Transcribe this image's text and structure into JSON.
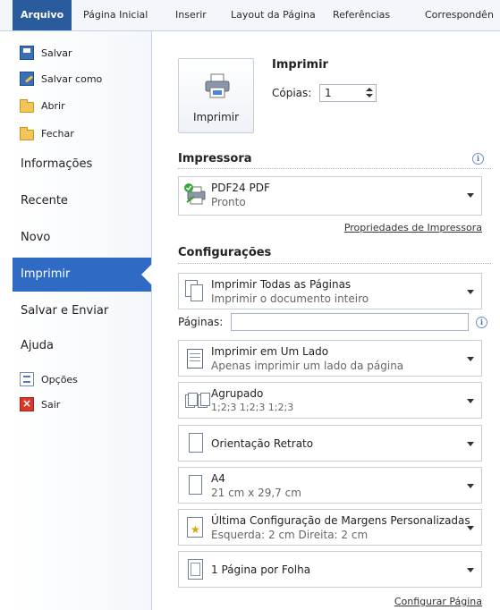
{
  "ribbon": {
    "tabs": [
      "Arquivo",
      "Página Inicial",
      "Inserir",
      "Layout da Página",
      "Referências",
      "Correspondên"
    ]
  },
  "nav": {
    "save": "Salvar",
    "save_as": "Salvar como",
    "open": "Abrir",
    "close": "Fechar",
    "info": "Informações",
    "recent": "Recente",
    "new": "Novo",
    "print": "Imprimir",
    "save_send": "Salvar e Enviar",
    "help": "Ajuda",
    "options": "Opções",
    "exit": "Sair"
  },
  "print": {
    "heading": "Imprimir",
    "button_label": "Imprimir",
    "copies_label": "Cópias:",
    "copies_value": "1"
  },
  "printer": {
    "section": "Impressora",
    "name": "PDF24 PDF",
    "status": "Pronto",
    "properties_link": "Propriedades de Impressora"
  },
  "settings": {
    "section": "Configurações",
    "pages_label": "Páginas:",
    "pages_value": "",
    "page_setup_link": "Configurar Página",
    "items": [
      {
        "title": "Imprimir Todas as Páginas",
        "subtitle": "Imprimir o documento inteiro",
        "icon": "pages-icon"
      },
      {
        "title": "Imprimir em Um Lado",
        "subtitle": "Apenas imprimir um lado da página",
        "icon": "one-side-icon"
      },
      {
        "title": "Agrupado",
        "subtitle": "1;2;3   1;2;3   1;2;3",
        "icon": "collate-icon"
      },
      {
        "title": "Orientação Retrato",
        "subtitle": "",
        "icon": "portrait-icon"
      },
      {
        "title": "A4",
        "subtitle": "21 cm x 29,7 cm",
        "icon": "paper-size-icon"
      },
      {
        "title": "Última Configuração de Margens Personalizadas",
        "subtitle": "Esquerda:  2 cm    Direita:  2 cm",
        "icon": "margins-icon"
      },
      {
        "title": "1 Página por Folha",
        "subtitle": "",
        "icon": "pages-per-sheet-icon"
      }
    ]
  },
  "colors": {
    "file_tab": "#2a5b9c",
    "active_nav": "#2f6ac4"
  }
}
